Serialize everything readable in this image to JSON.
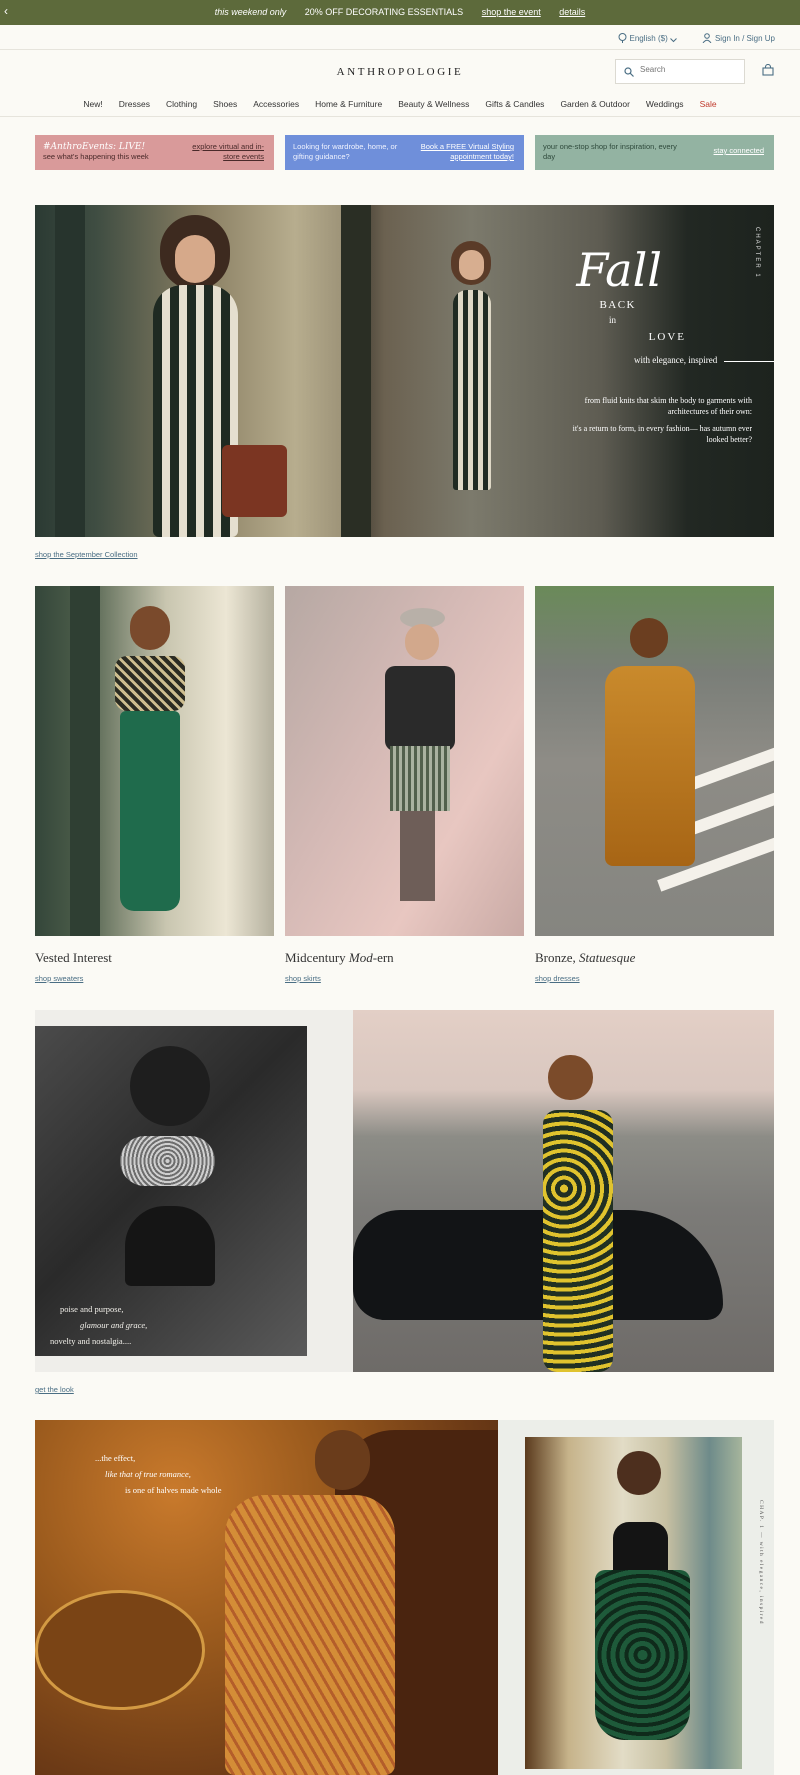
{
  "promo": {
    "back_glyph": "‹",
    "italic_text": "this weekend only",
    "headline": "20% OFF DECORATING ESSENTIALS",
    "link_event": "shop the event",
    "link_details": "details"
  },
  "util": {
    "language": "English ($)",
    "signin": "Sign In / Sign Up"
  },
  "header": {
    "logo": "ANTHROPOLOGIE",
    "search_placeholder": "Search"
  },
  "nav": [
    "New!",
    "Dresses",
    "Clothing",
    "Shoes",
    "Accessories",
    "Home & Furniture",
    "Beauty & Wellness",
    "Gifts & Candles",
    "Garden & Outdoor",
    "Weddings",
    "Sale"
  ],
  "banners": {
    "b1": {
      "script": "#AnthroEvents: LIVE!",
      "sub": "see what's happening this week",
      "link": "explore virtual and in-store events"
    },
    "b2": {
      "text": "Looking for wardrobe, home, or gifting guidance?",
      "link": "Book a FREE Virtual Styling appointment today!"
    },
    "b3": {
      "text": "your one-stop shop for inspiration, every day",
      "link": "stay connected"
    }
  },
  "hero": {
    "fall": "Fall",
    "back": "BACK",
    "in": "in",
    "love": "LOVE",
    "elegance": "with elegance, inspired",
    "para1": "from fluid knits that skim the body to garments with architectures of their own:",
    "para2": "it's a return to form, in every fashion— has autumn ever looked better?",
    "chapter": "CHAPTER 1",
    "link": "shop the September Collection"
  },
  "tiles": [
    {
      "title_a": "Vested Interest",
      "title_i": "",
      "title_b": "",
      "link": "shop sweaters"
    },
    {
      "title_a": "Midcentury ",
      "title_i": "Mod",
      "title_b": "-ern",
      "link": "shop skirts"
    },
    {
      "title_a": "Bronze, ",
      "title_i": "Statuesque",
      "title_b": "",
      "link": "shop dresses"
    }
  ],
  "feature2": {
    "line1": "poise and purpose,",
    "line2": "glamour and grace,",
    "line3": "novelty and nostalgia....",
    "link": "get the look"
  },
  "feature3": {
    "line1": "...the effect,",
    "line2": "like that of true romance,",
    "line3": "is one of halves made whole",
    "side": "CHAP. 1 — with elegance, inspired"
  },
  "colors": {
    "promo_bg": "#5d6a3b",
    "link": "#4a6e84",
    "sale": "#c0392b",
    "banner1": "#d99a9a",
    "banner2": "#6f8fda",
    "banner3": "#93b3a2"
  }
}
